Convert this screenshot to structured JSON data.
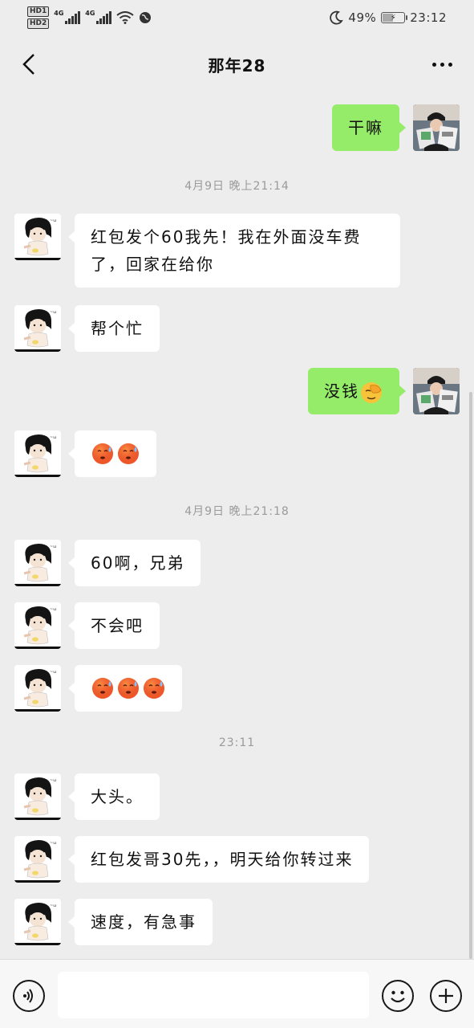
{
  "status_bar": {
    "hd1": "HD1",
    "hd2": "HD2",
    "net1": "4G",
    "net2": "4G",
    "battery_percent": "49%",
    "battery_level": 0.49,
    "time": "23:12"
  },
  "header": {
    "title": "那年28"
  },
  "messages": [
    {
      "id": "m1",
      "side": "right",
      "text": "干嘛"
    },
    {
      "id": "t1",
      "type": "time",
      "text": "4月9日 晚上21:14"
    },
    {
      "id": "m2",
      "side": "left",
      "text_lines": [
        "红包发个60我先！我在外面没车费",
        "了，回家在给你"
      ]
    },
    {
      "id": "m3",
      "side": "left",
      "text": "帮个忙"
    },
    {
      "id": "m4",
      "side": "right",
      "text": "没钱",
      "emoji": "facepalm-emoji"
    },
    {
      "id": "m5",
      "side": "left",
      "emoji": "anxious-sweat-emoji",
      "emoji_count": 2
    },
    {
      "id": "t2",
      "type": "time",
      "text": "4月9日 晚上21:18"
    },
    {
      "id": "m6",
      "side": "left",
      "text": "60啊，兄弟"
    },
    {
      "id": "m7",
      "side": "left",
      "text": "不会吧"
    },
    {
      "id": "m8",
      "side": "left",
      "emoji": "anxious-sweat-emoji",
      "emoji_count": 3
    },
    {
      "id": "t3",
      "type": "time",
      "text": "23:11"
    },
    {
      "id": "m9",
      "side": "left",
      "text": "大头。"
    },
    {
      "id": "m10",
      "side": "left",
      "text": "红包发哥30先，，明天给你转过来"
    },
    {
      "id": "m11",
      "side": "left",
      "text": "速度，有急事"
    }
  ],
  "colors": {
    "background": "#ededed",
    "my_bubble": "#95ec69",
    "their_bubble": "#ffffff",
    "timestamp": "#9a9a9a"
  },
  "input_bar": {
    "value": "",
    "placeholder": ""
  }
}
